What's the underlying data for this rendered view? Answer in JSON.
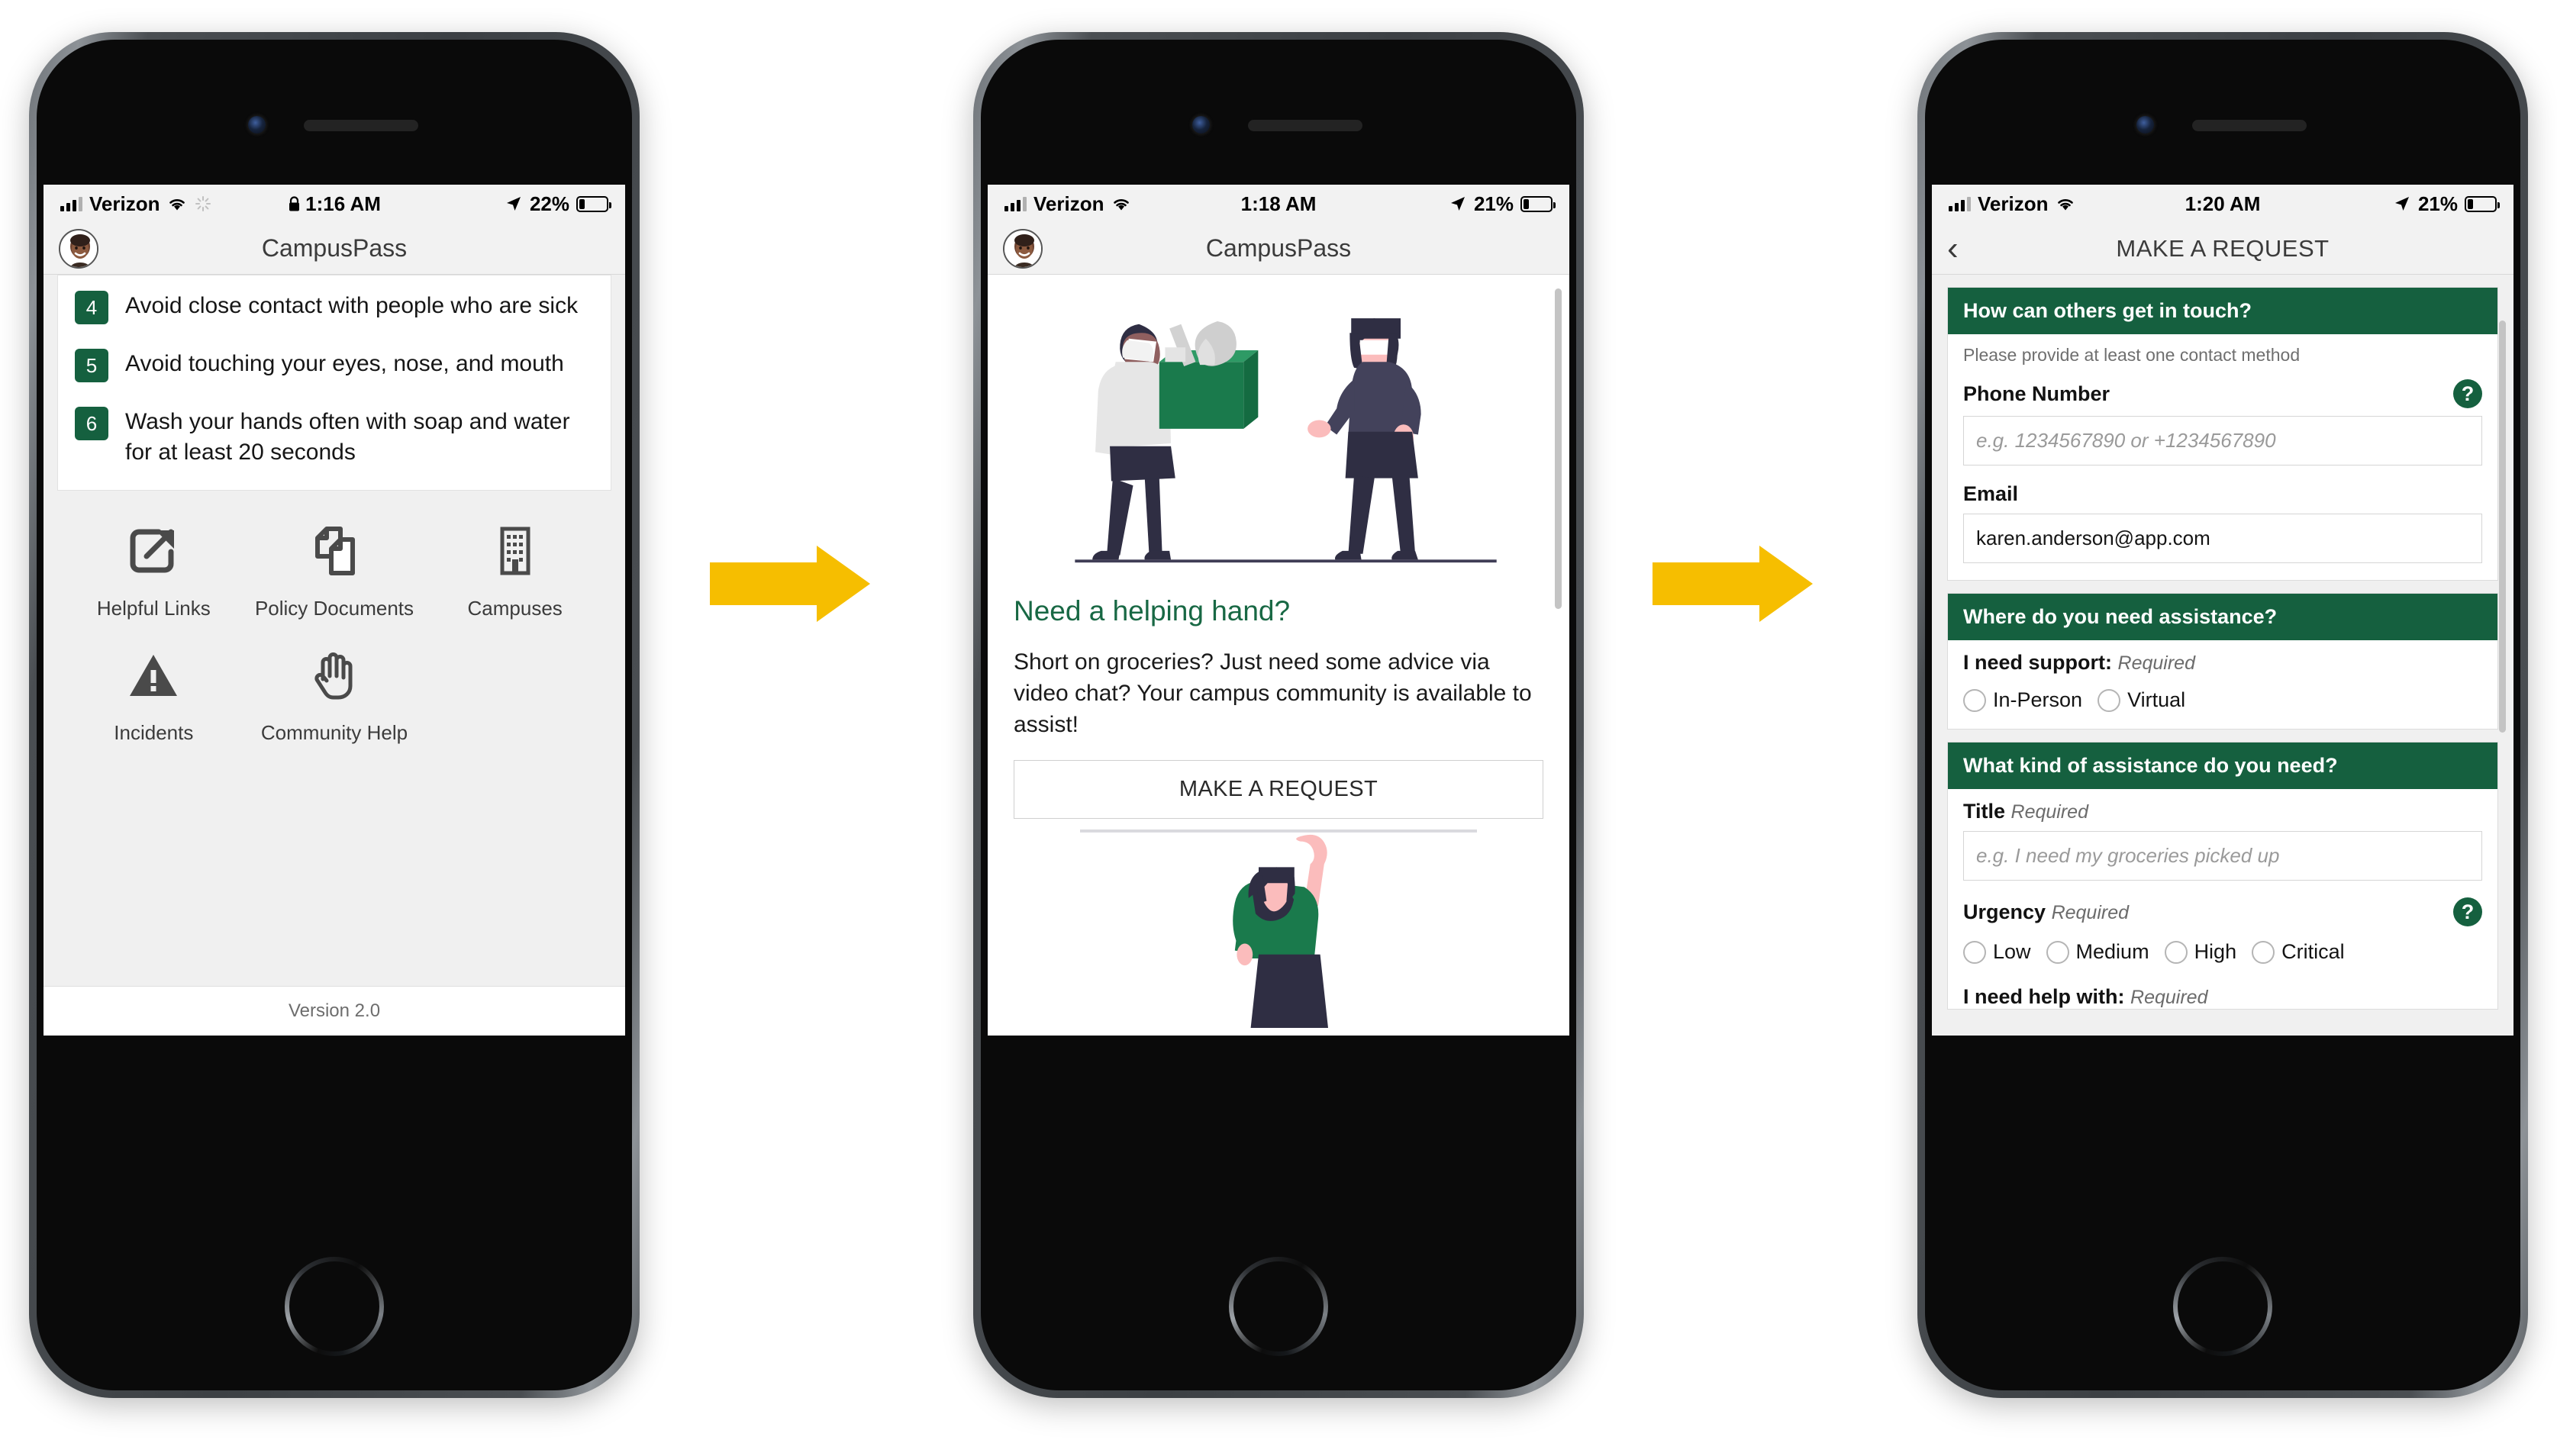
{
  "phones": [
    {
      "status": {
        "carrier": "Verizon",
        "time": "1:16 AM",
        "battery": "22%",
        "lock": true,
        "spinner": true
      },
      "header": {
        "title": "CampusPass"
      },
      "tips": [
        {
          "num": "4",
          "text": "Avoid close contact with people who are sick"
        },
        {
          "num": "5",
          "text": "Avoid touching your eyes, nose, and mouth"
        },
        {
          "num": "6",
          "text": "Wash your hands often with soap and water for at least 20 seconds"
        }
      ],
      "grid": [
        {
          "icon": "external-link-icon",
          "label": "Helpful Links"
        },
        {
          "icon": "documents-icon",
          "label": "Policy Documents"
        },
        {
          "icon": "building-icon",
          "label": "Campuses"
        },
        {
          "icon": "warning-triangle-icon",
          "label": "Incidents"
        },
        {
          "icon": "hand-icon",
          "label": "Community Help"
        }
      ],
      "version": "Version 2.0"
    },
    {
      "status": {
        "carrier": "Verizon",
        "time": "1:18 AM",
        "battery": "21%",
        "lock": false,
        "spinner": false
      },
      "header": {
        "title": "CampusPass"
      },
      "heading": "Need a helping hand?",
      "paragraph": "Short on groceries? Just need some advice via video chat? Your campus community is available to assist!",
      "button": "MAKE A REQUEST"
    },
    {
      "status": {
        "carrier": "Verizon",
        "time": "1:20 AM",
        "battery": "21%",
        "lock": false,
        "spinner": false
      },
      "header": {
        "title": "MAKE A REQUEST",
        "back": "‹"
      },
      "sections": [
        {
          "title": "How can others get in touch?",
          "hint": "Please provide at least one contact method",
          "phone_label": "Phone Number",
          "phone_placeholder": "e.g. 1234567890 or +1234567890",
          "email_label": "Email",
          "email_value": "karen.anderson@app.com"
        },
        {
          "title": "Where do you need assistance?",
          "support_label": "I need support:",
          "support_required": "Required",
          "support_options": [
            "In-Person",
            "Virtual"
          ]
        },
        {
          "title": "What kind of assistance do you need?",
          "title_label": "Title",
          "title_required": "Required",
          "title_placeholder": "e.g. I need my groceries picked up",
          "urgency_label": "Urgency",
          "urgency_required": "Required",
          "urgency_options": [
            "Low",
            "Medium",
            "High",
            "Critical"
          ],
          "cut_label": "I need help with:",
          "cut_required": "Required"
        }
      ]
    }
  ],
  "colors": {
    "green": "#15603F",
    "green_text": "#186844",
    "arrow": "#F6BE00"
  }
}
